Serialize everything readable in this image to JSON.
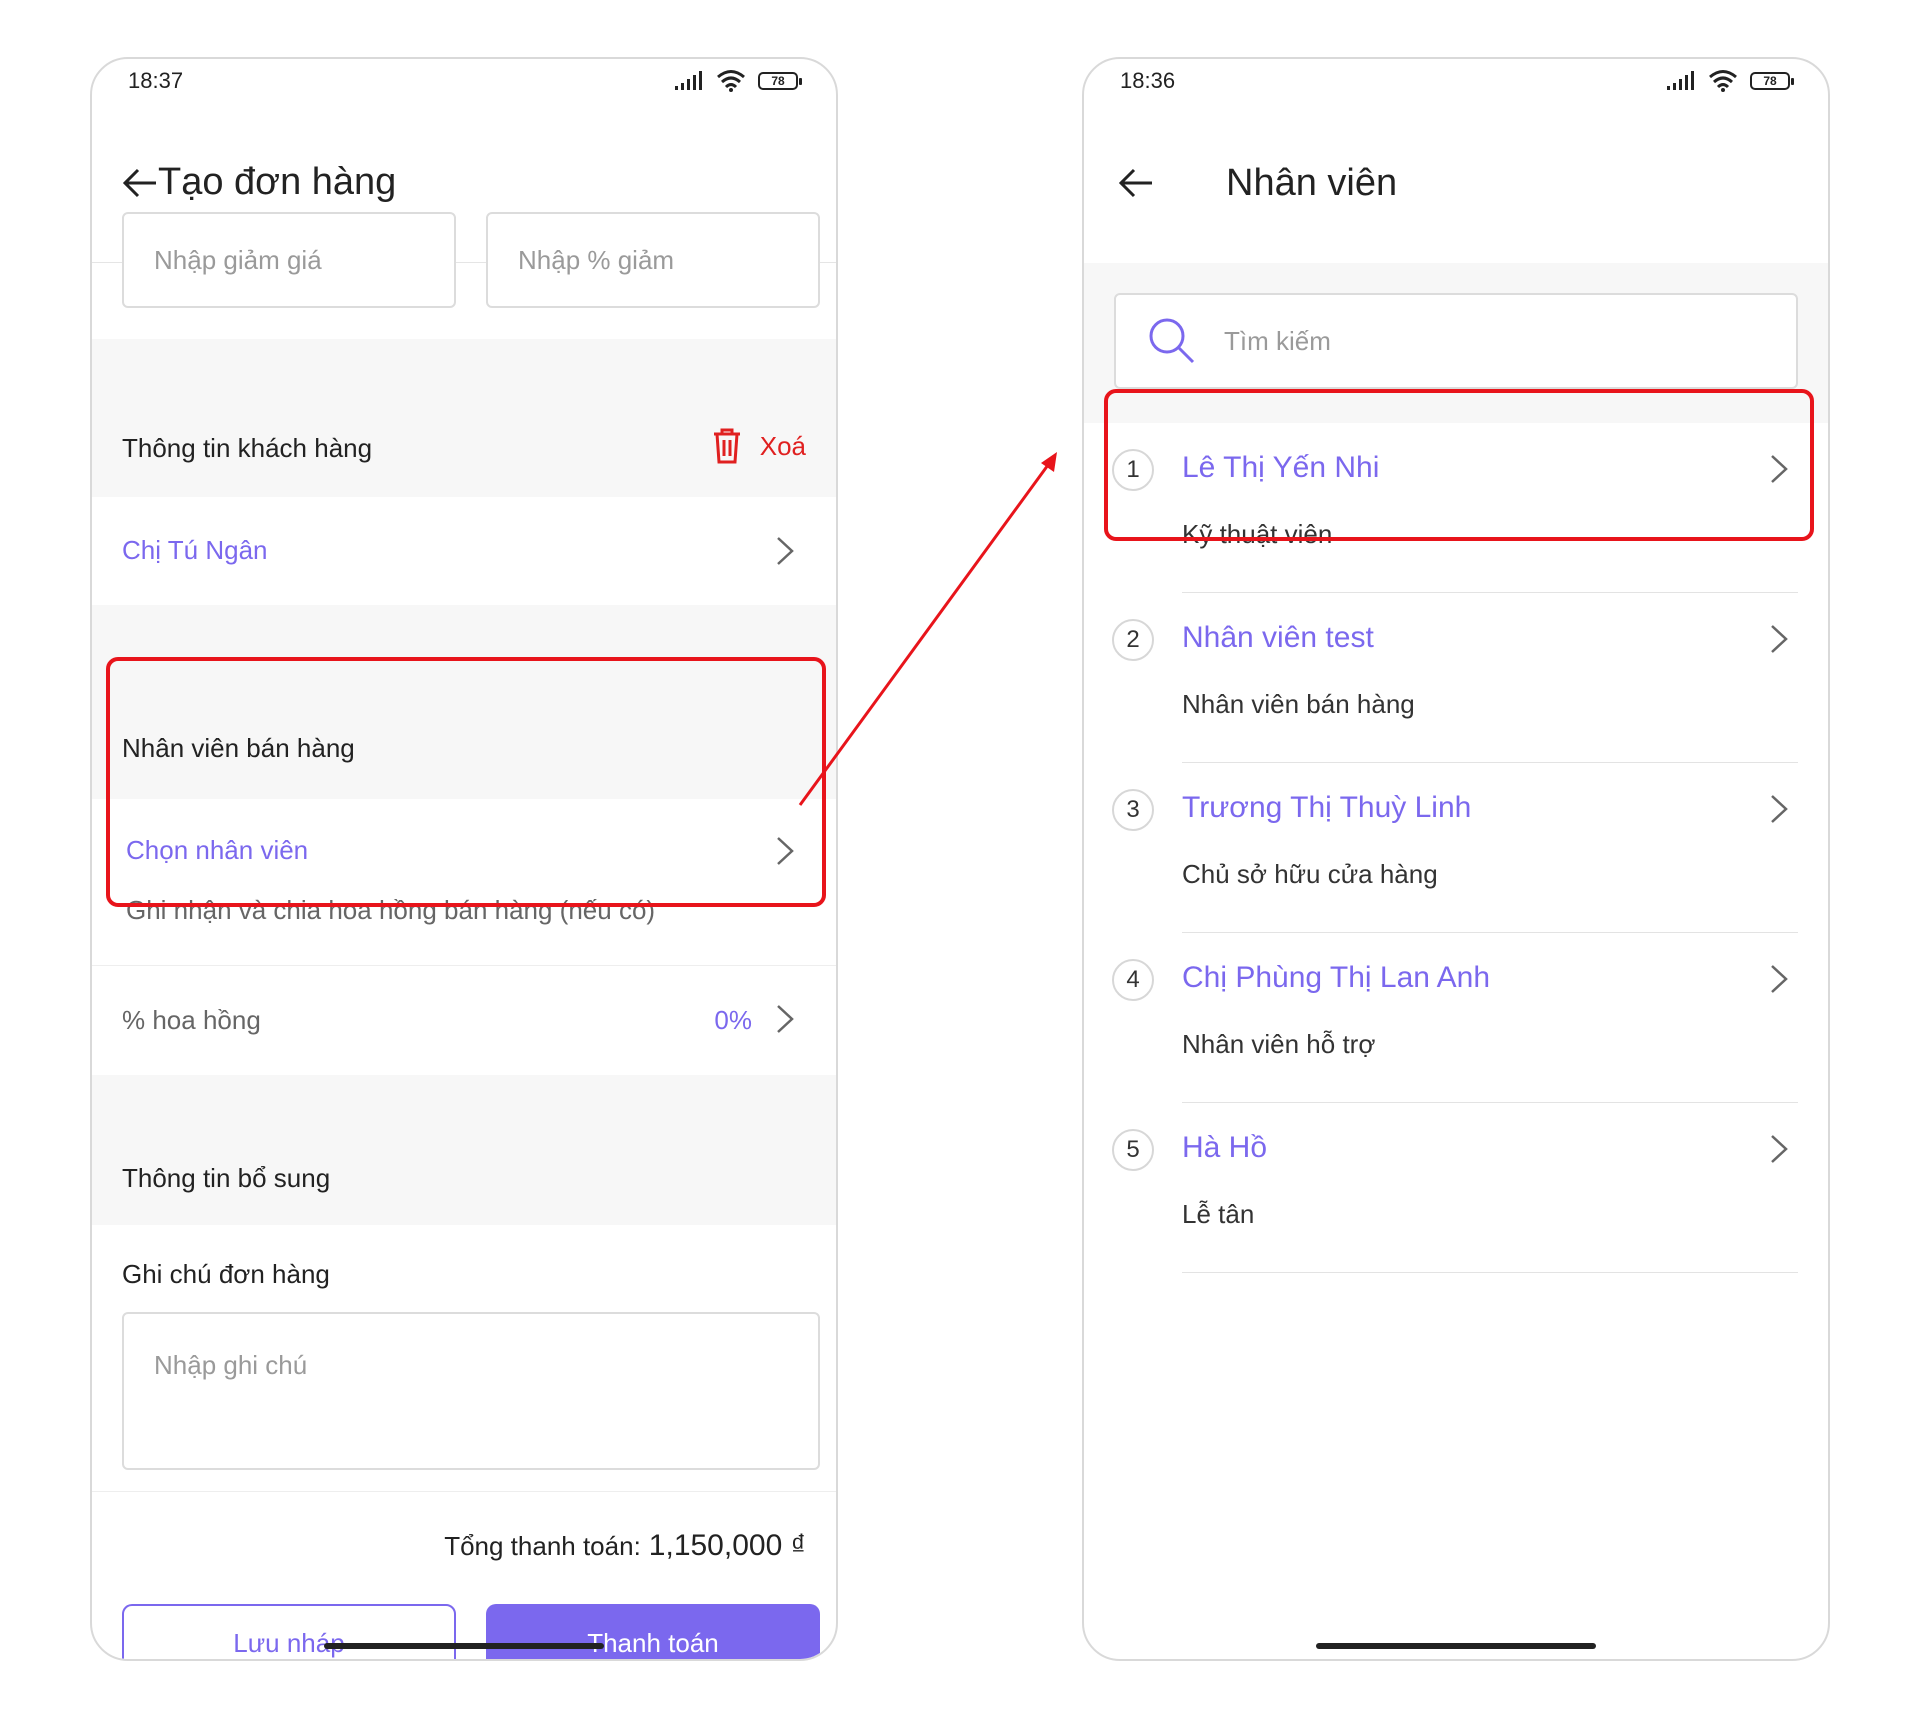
{
  "left_screen": {
    "status_time": "18:37",
    "battery": "78",
    "header_title": "Tạo đơn hàng",
    "discount_placeholder": "Nhập giảm giá",
    "discount_percent_placeholder": "Nhập % giảm",
    "customer_section_title": "Thông tin khách hàng",
    "delete_label": "Xoá",
    "customer_name": "Chị Tú Ngân",
    "sales_staff_title": "Nhân viên bán hàng",
    "choose_staff_label": "Chọn nhân viên",
    "choose_staff_hint": "Ghi nhận và chia hoa hồng bán hàng (nếu có)",
    "commission_label": "% hoa hồng",
    "commission_value": "0%",
    "extra_info_title": "Thông tin bổ sung",
    "order_note_label": "Ghi chú đơn hàng",
    "order_note_placeholder": "Nhập ghi chú",
    "total_label": "Tổng thanh toán:",
    "total_value": "1,150,000 ₫",
    "save_draft_label": "Lưu nháp",
    "pay_label": "Thanh toán"
  },
  "right_screen": {
    "status_time": "18:36",
    "battery": "78",
    "header_title": "Nhân viên",
    "search_placeholder": "Tìm kiếm",
    "employees": [
      {
        "index": "1",
        "name": "Lê Thị Yến Nhi",
        "role": "Kỹ thuật viên"
      },
      {
        "index": "2",
        "name": "Nhân viên test",
        "role": "Nhân viên bán hàng"
      },
      {
        "index": "3",
        "name": "Trương Thị Thuỳ Linh",
        "role": "Chủ sở hữu cửa hàng"
      },
      {
        "index": "4",
        "name": "Chị Phùng Thị Lan Anh",
        "role": "Nhân viên hỗ trợ"
      },
      {
        "index": "5",
        "name": "Hà Hồ",
        "role": "Lễ tân"
      }
    ]
  },
  "colors": {
    "accent": "#7b68ee",
    "delete_red": "#e02020",
    "highlight_red": "#e8141b"
  }
}
